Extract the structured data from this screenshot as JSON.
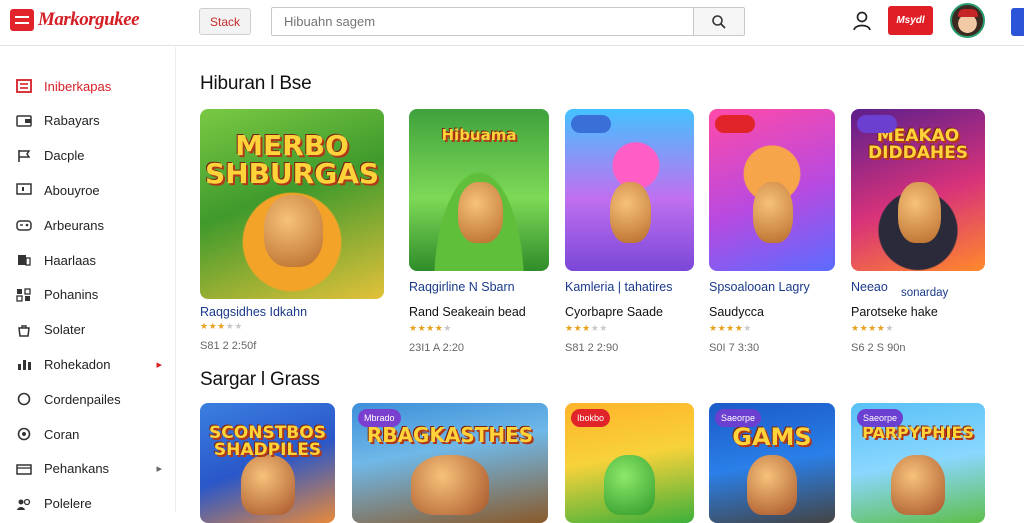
{
  "app": {
    "logo_text": "Markorgukee",
    "stack_button": "Stack",
    "search_placeholder": "Hibuahn sagem",
    "promo_label": "Msydl"
  },
  "sidebar": {
    "items": [
      {
        "label": "Iniberkapas",
        "icon": "library-icon",
        "active": true
      },
      {
        "label": "Rabayars",
        "icon": "wallet-icon"
      },
      {
        "label": "Dacple",
        "icon": "flag-icon"
      },
      {
        "label": "Abouyroe",
        "icon": "tv-icon"
      },
      {
        "label": "Arbeurans",
        "icon": "gamepad-icon"
      },
      {
        "label": "Haarlaas",
        "icon": "bookmark-icon"
      },
      {
        "label": "Pohanins",
        "icon": "grid-icon"
      },
      {
        "label": "Solater",
        "icon": "bag-icon"
      },
      {
        "label": "Rohekadon",
        "icon": "chart-icon",
        "chevron": "red"
      },
      {
        "label": "Cordenpailes",
        "icon": "chat-icon"
      },
      {
        "label": "Coran",
        "icon": "globe-icon"
      },
      {
        "label": "Pehankans",
        "icon": "box-icon",
        "chevron": "grey"
      },
      {
        "label": "Polelere",
        "icon": "people-icon"
      }
    ]
  },
  "sections": [
    {
      "title": "Hiburan l Bse",
      "cards": [
        {
          "thumb_title": "MERBO SHBURGAS",
          "name": "Raqgsidhes Idkahn",
          "sub": "",
          "stars": 3,
          "meta": "S81 2 2:50f"
        },
        {
          "thumb_title": "Hibuama",
          "name": "Raqgirline N Sbarn",
          "sub": "Rand Seakeain bead",
          "stars": 4,
          "meta": "23I1 A 2:20"
        },
        {
          "thumb_title": "",
          "name": "Kamleria | tahatires",
          "sub": "Cyorbapre Saade",
          "stars": 3,
          "meta": "S81 2 2:90"
        },
        {
          "thumb_title": "",
          "name": "Spsoalooan Lagry",
          "sub": "Saudycca",
          "stars": 4,
          "meta": "S0I 7 3:30"
        },
        {
          "thumb_title": "MEAKAO DIDDAHES",
          "name": "Neeao",
          "name2": "sonarday",
          "sub": "Parotseke hake",
          "stars": 4,
          "meta": "S6 2 S 90n"
        }
      ]
    },
    {
      "title": "Sargar l Grass",
      "cards": [
        {
          "thumb_title": "SCONSTBOS SHADPILES"
        },
        {
          "thumb_title": "RBAGKASTHES",
          "badge": "Mbrado"
        },
        {
          "thumb_title": "",
          "badge": "Ibokbo"
        },
        {
          "thumb_title": "GAMS",
          "badge": "Saeorpe"
        },
        {
          "thumb_title": "PARPYPHIES",
          "badge": "Saeorpe"
        }
      ]
    }
  ],
  "colors": {
    "brand_red": "#d61f26",
    "link_blue": "#1a3a8a",
    "star": "#e6a11f"
  }
}
